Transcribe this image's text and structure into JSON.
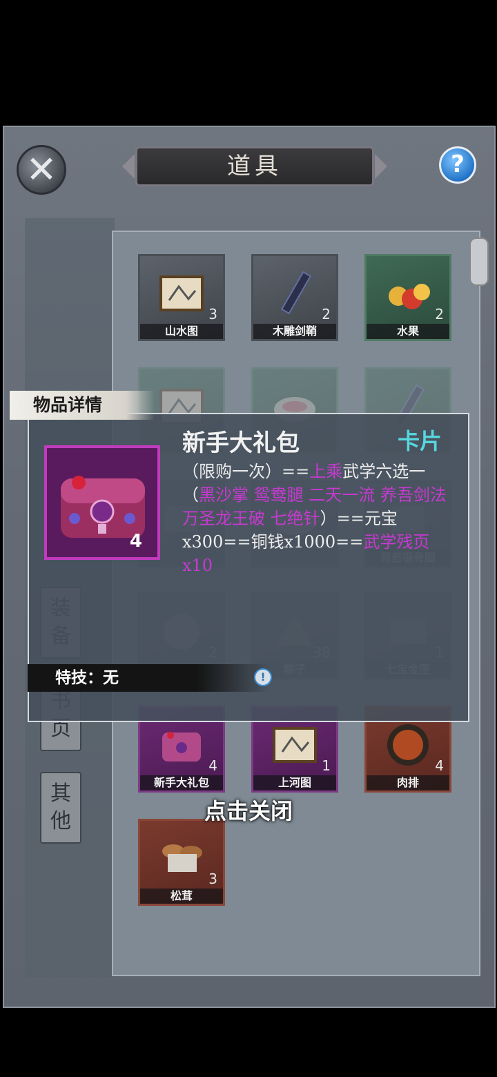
{
  "header": {
    "title": "道具"
  },
  "side_tabs": [
    {
      "label": "装\n备"
    },
    {
      "label": "书\n页"
    },
    {
      "label": "其\n他"
    }
  ],
  "grid": [
    {
      "name": "山水图",
      "count": "3",
      "rarity": "gray",
      "icon": "scroll-painting-icon"
    },
    {
      "name": "木雕剑鞘",
      "count": "2",
      "rarity": "gray",
      "icon": "sword-sheath-icon"
    },
    {
      "name": "水果",
      "count": "2",
      "rarity": "green",
      "icon": "fruit-basket-icon"
    },
    {
      "name": "",
      "count": "",
      "rarity": "green",
      "icon": "scroll-painting-icon"
    },
    {
      "name": "",
      "count": "",
      "rarity": "green",
      "icon": "bowl-icon"
    },
    {
      "name": "",
      "count": "",
      "rarity": "green",
      "icon": "sword-sheath-icon"
    },
    {
      "name": "",
      "count": "",
      "rarity": "gray",
      "icon": "scroll-icon"
    },
    {
      "name": "",
      "count": "",
      "rarity": "gray",
      "icon": "bowl-icon"
    },
    {
      "name": "易筋锻骨图",
      "count": "",
      "rarity": "gray",
      "icon": "scroll-icon"
    },
    {
      "name": "",
      "count": "2",
      "rarity": "gray",
      "icon": "plate-icon"
    },
    {
      "name": "粽子",
      "count": "38",
      "rarity": "gray",
      "icon": "zongzi-icon"
    },
    {
      "name": "七宝金匣",
      "count": "1",
      "rarity": "gray",
      "icon": "box-icon"
    },
    {
      "name": "新手大礼包",
      "count": "4",
      "rarity": "purple",
      "icon": "treasure-chest-icon"
    },
    {
      "name": "上河图",
      "count": "1",
      "rarity": "purple",
      "icon": "scroll-painting-icon"
    },
    {
      "name": "肉排",
      "count": "4",
      "rarity": "red",
      "icon": "meat-dish-icon"
    },
    {
      "name": "松茸",
      "count": "3",
      "rarity": "red",
      "icon": "mushroom-icon"
    }
  ],
  "detail": {
    "tab_label": "物品详情",
    "item_name": "新手大礼包",
    "item_kind": "卡片",
    "count": "4",
    "desc_parts": [
      {
        "text": "（限购一次）==",
        "hl": false
      },
      {
        "text": "上乘",
        "hl": true
      },
      {
        "text": "武学六选一（",
        "hl": false
      },
      {
        "text": "黑沙掌 鸳鸯腿 二天一流 养吾剑法 万圣龙王破 七绝针",
        "hl": true
      },
      {
        "text": "）==元宝x300==铜钱x1000==",
        "hl": false
      },
      {
        "text": "武学残页x10",
        "hl": true
      }
    ],
    "skill_label": "特技：无",
    "skill_info_icon": "info-icon"
  },
  "footer": {
    "tap_close": "点击关闭"
  },
  "colors": {
    "highlight": "#c63ad0",
    "kind": "#57d7df",
    "purple_border": "#c13bbd"
  }
}
